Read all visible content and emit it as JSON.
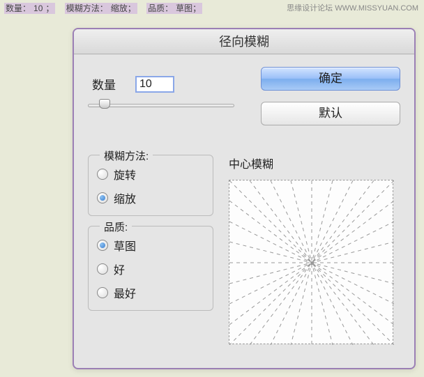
{
  "watermark": {
    "site": "思缘设计论坛",
    "url": "WWW.MISSYUAN.COM"
  },
  "topbar": {
    "amount_label": "数量：",
    "amount_value": "10",
    "sep1": "；",
    "method_label": "模糊方法：",
    "method_value": "缩放；",
    "quality_label": "品质：",
    "quality_value": "草图；"
  },
  "dialog": {
    "title": "径向模糊",
    "amount": {
      "label": "数量",
      "value": "10"
    },
    "buttons": {
      "ok": "确定",
      "reset": "默认"
    },
    "method_group": {
      "title": "模糊方法:",
      "options": [
        {
          "label": "旋转",
          "selected": false
        },
        {
          "label": "缩放",
          "selected": true
        }
      ]
    },
    "quality_group": {
      "title": "品质:",
      "options": [
        {
          "label": "草图",
          "selected": true
        },
        {
          "label": "好",
          "selected": false
        },
        {
          "label": "最好",
          "selected": false
        }
      ]
    },
    "preview_title": "中心模糊"
  }
}
